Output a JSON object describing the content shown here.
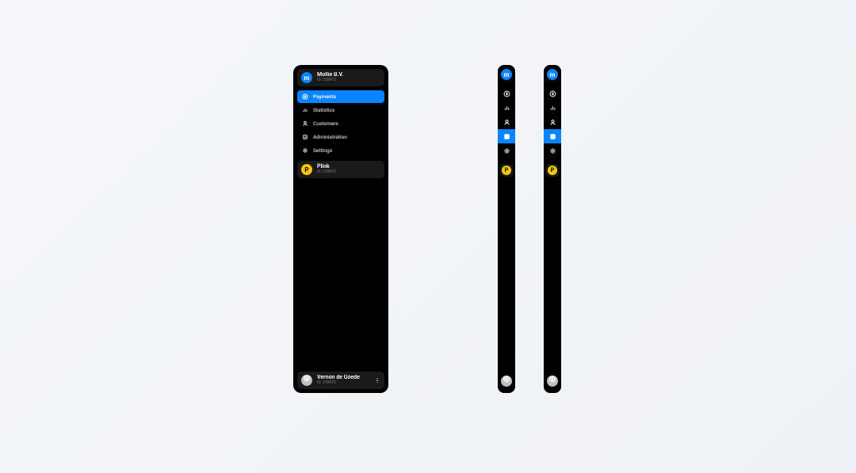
{
  "colors": {
    "accent": "#0a84ff",
    "plink": "#f7c600",
    "bg_panel": "#000000",
    "bg_block": "#1a1a1a"
  },
  "org": {
    "logo_letter": "m",
    "name": "Mollie B.V.",
    "id_label": "ID: 238472"
  },
  "nav": {
    "items": [
      {
        "icon": "payment-icon",
        "label": "Payments",
        "active_in": "expanded"
      },
      {
        "icon": "stats-icon",
        "label": "Statistics",
        "active_in": null
      },
      {
        "icon": "customers-icon",
        "label": "Customers",
        "active_in": null
      },
      {
        "icon": "admin-icon",
        "label": "Administration",
        "active_in": "mini-b"
      },
      {
        "icon": "settings-icon",
        "label": "Settings",
        "active_in": null
      }
    ]
  },
  "plink": {
    "logo_letter": "P",
    "name": "Plink",
    "id_label": "ID: 238472"
  },
  "user": {
    "name": "Vernon de Goede",
    "id_label": "ID: 238472"
  },
  "mini_variants": {
    "a": {
      "active_index": null,
      "active_blue_index": 3
    },
    "b": {
      "active_index": null,
      "active_blue_index": 3
    }
  }
}
